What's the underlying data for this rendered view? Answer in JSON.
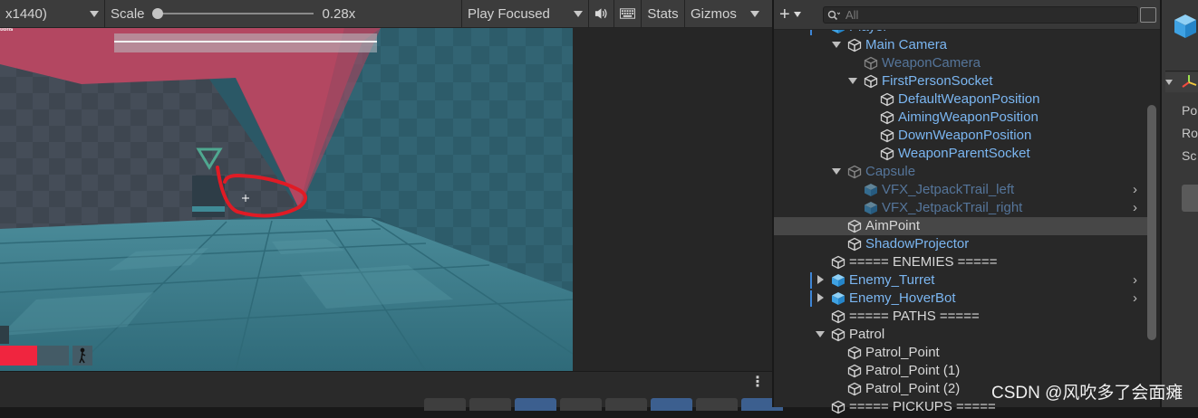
{
  "game_toolbar": {
    "resolution": "x1440)",
    "scale_label": "Scale",
    "scale_value": "0.28x",
    "scale_fraction": 0.0,
    "play_mode": "Play Focused",
    "stats": "Stats",
    "gizmos": "Gizmos"
  },
  "game_overlay": {
    "corner_text": "tions"
  },
  "hierarchy": {
    "search_placeholder": "All",
    "items": [
      {
        "label": "Player",
        "depth": 1,
        "arrow": "none",
        "style": "prefab",
        "chevron": true,
        "mark": true
      },
      {
        "label": "Main Camera",
        "depth": 2,
        "arrow": "down",
        "style": "prefab"
      },
      {
        "label": "WeaponCamera",
        "depth": 3,
        "arrow": "none",
        "style": "prefab-inactive"
      },
      {
        "label": "FirstPersonSocket",
        "depth": 3,
        "arrow": "down",
        "style": "prefab"
      },
      {
        "label": "DefaultWeaponPosition",
        "depth": 4,
        "arrow": "none",
        "style": "prefab"
      },
      {
        "label": "AimingWeaponPosition",
        "depth": 4,
        "arrow": "none",
        "style": "prefab"
      },
      {
        "label": "DownWeaponPosition",
        "depth": 4,
        "arrow": "none",
        "style": "prefab"
      },
      {
        "label": "WeaponParentSocket",
        "depth": 4,
        "arrow": "none",
        "style": "prefab"
      },
      {
        "label": "Capsule",
        "depth": 2,
        "arrow": "down",
        "style": "prefab-inactive"
      },
      {
        "label": "VFX_JetpackTrail_left",
        "depth": 3,
        "arrow": "none",
        "style": "prefab-inactive",
        "chevron": true,
        "bluecube": true
      },
      {
        "label": "VFX_JetpackTrail_right",
        "depth": 3,
        "arrow": "none",
        "style": "prefab-inactive",
        "chevron": true,
        "bluecube": true
      },
      {
        "label": "AimPoint",
        "depth": 2,
        "arrow": "none",
        "style": "normal",
        "selected": true
      },
      {
        "label": "ShadowProjector",
        "depth": 2,
        "arrow": "none",
        "style": "prefab"
      },
      {
        "label": "===== ENEMIES =====",
        "depth": 1,
        "arrow": "none",
        "style": "normal"
      },
      {
        "label": "Enemy_Turret",
        "depth": 1,
        "arrow": "right",
        "style": "prefab",
        "chevron": true,
        "bluecube": true,
        "mark": true
      },
      {
        "label": "Enemy_HoverBot",
        "depth": 1,
        "arrow": "right",
        "style": "prefab",
        "chevron": true,
        "bluecube": true,
        "mark": true
      },
      {
        "label": "===== PATHS =====",
        "depth": 1,
        "arrow": "none",
        "style": "normal"
      },
      {
        "label": "Patrol",
        "depth": 1,
        "arrow": "down",
        "style": "normal"
      },
      {
        "label": "Patrol_Point",
        "depth": 2,
        "arrow": "none",
        "style": "normal"
      },
      {
        "label": "Patrol_Point (1)",
        "depth": 2,
        "arrow": "none",
        "style": "normal"
      },
      {
        "label": "Patrol_Point (2)",
        "depth": 2,
        "arrow": "none",
        "style": "normal"
      },
      {
        "label": "===== PICKUPS =====",
        "depth": 1,
        "arrow": "none",
        "style": "normal"
      }
    ]
  },
  "inspector": {
    "labels": [
      "Po",
      "Ro",
      "Sc"
    ]
  },
  "watermark": "CSDN @风吹多了会面瘫"
}
